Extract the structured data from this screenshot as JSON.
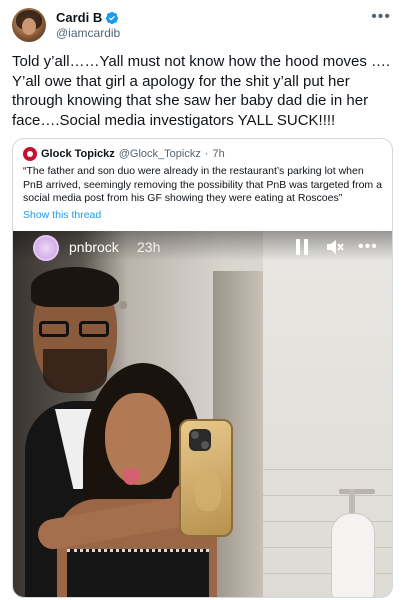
{
  "tweet": {
    "display_name": "Cardi B",
    "handle": "@iamcardib",
    "more_icon": "more-horizontal-icon",
    "verified_icon": "verified-badge-icon",
    "text": "Told y’all……Yall must not know how the hood moves …. Y’all owe that girl a apology for the shit y’all put her through knowing that she saw her baby dad die in her face….Social media investigators YALL SUCK!!!!"
  },
  "quoted_tweet": {
    "display_name": "Glock Topickz",
    "handle": "@Glock_Topickz",
    "separator": "·",
    "time": "7h",
    "text": "“The father and son duo were already in the restaurant’s parking lot when PnB arrived, seemingly removing the possibility that PnB was targeted from a social media post from his GF showing they were eating at Roscoes”",
    "show_thread_label": "Show this thread"
  },
  "story": {
    "username": "pnbrock",
    "time": "23h",
    "icons": [
      "pause-icon",
      "mute-icon",
      "more-horizontal-icon"
    ]
  },
  "colors": {
    "link_blue": "#1d9bf0",
    "verified_blue": "#1d9bf0",
    "secondary_text": "#536471",
    "border": "#cfd9de"
  }
}
